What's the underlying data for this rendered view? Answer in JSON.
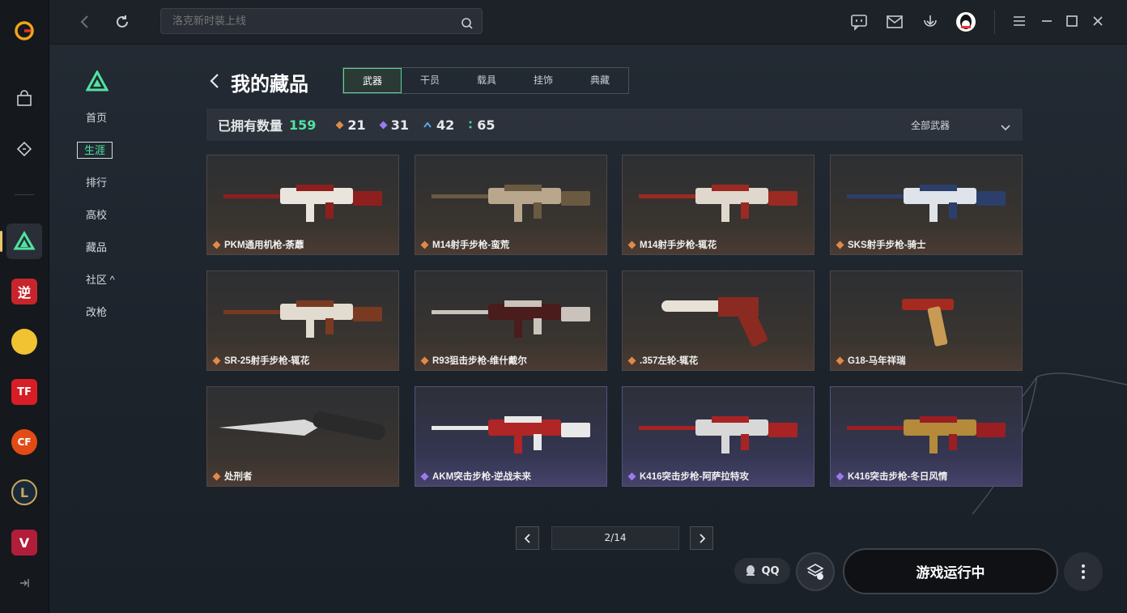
{
  "app": {
    "title": "WeGame"
  },
  "search": {
    "placeholder": "洛克新时装上线"
  },
  "subnav": {
    "items": [
      {
        "label": "首页"
      },
      {
        "label": "生涯",
        "active": true
      },
      {
        "label": "排行"
      },
      {
        "label": "高校"
      },
      {
        "label": "藏品"
      },
      {
        "label": "社区 ^"
      },
      {
        "label": "改枪"
      }
    ]
  },
  "page": {
    "title": "我的藏品"
  },
  "tabs": [
    {
      "label": "武器",
      "active": true
    },
    {
      "label": "干员"
    },
    {
      "label": "载具"
    },
    {
      "label": "挂饰"
    },
    {
      "label": "典藏"
    }
  ],
  "stats": {
    "owned_label": "已拥有数量",
    "owned_count": "159",
    "orange_count": "21",
    "purple_count": "31",
    "blue_count": "42",
    "green_count": "65",
    "filter_label": "全部武器"
  },
  "colors": {
    "accent_green": "#4fe3a1",
    "orange_rarity": "#e08a4a",
    "purple_rarity": "#9b7af0",
    "blue_rarity": "#5aa7e8",
    "green_rarity": "#4fd3a0"
  },
  "items": [
    {
      "name": "PKM通用机枪-荼蘼",
      "rarity": "orange"
    },
    {
      "name": "M14射手步枪-蛮荒",
      "rarity": "orange"
    },
    {
      "name": "M14射手步枪-辄花",
      "rarity": "orange"
    },
    {
      "name": "SKS射手步枪-骑士",
      "rarity": "orange"
    },
    {
      "name": "SR-25射手步枪-辄花",
      "rarity": "orange"
    },
    {
      "name": "R93狙击步枪-维什戴尔",
      "rarity": "orange"
    },
    {
      "name": ".357左轮-辄花",
      "rarity": "orange"
    },
    {
      "name": "G18-马年祥瑞",
      "rarity": "orange"
    },
    {
      "name": "处刑者",
      "rarity": "orange"
    },
    {
      "name": "AKM突击步枪-逆战未来",
      "rarity": "purple"
    },
    {
      "name": "K416突击步枪-阿萨拉特攻",
      "rarity": "purple"
    },
    {
      "name": "K416突击步枪-冬日风情",
      "rarity": "purple"
    }
  ],
  "pager": {
    "text": "2/14"
  },
  "bottom": {
    "qq_label": "QQ",
    "launch_label": "游戏运行中"
  },
  "rail_games": [
    {
      "label": "逆",
      "color": "#c6252b"
    },
    {
      "label": "TF",
      "color": "#d81e25"
    },
    {
      "label": "CF",
      "color": "#e24b16"
    },
    {
      "label": "L",
      "color": "#1b2a3a"
    },
    {
      "label": "V",
      "color": "#b01e3a"
    }
  ]
}
